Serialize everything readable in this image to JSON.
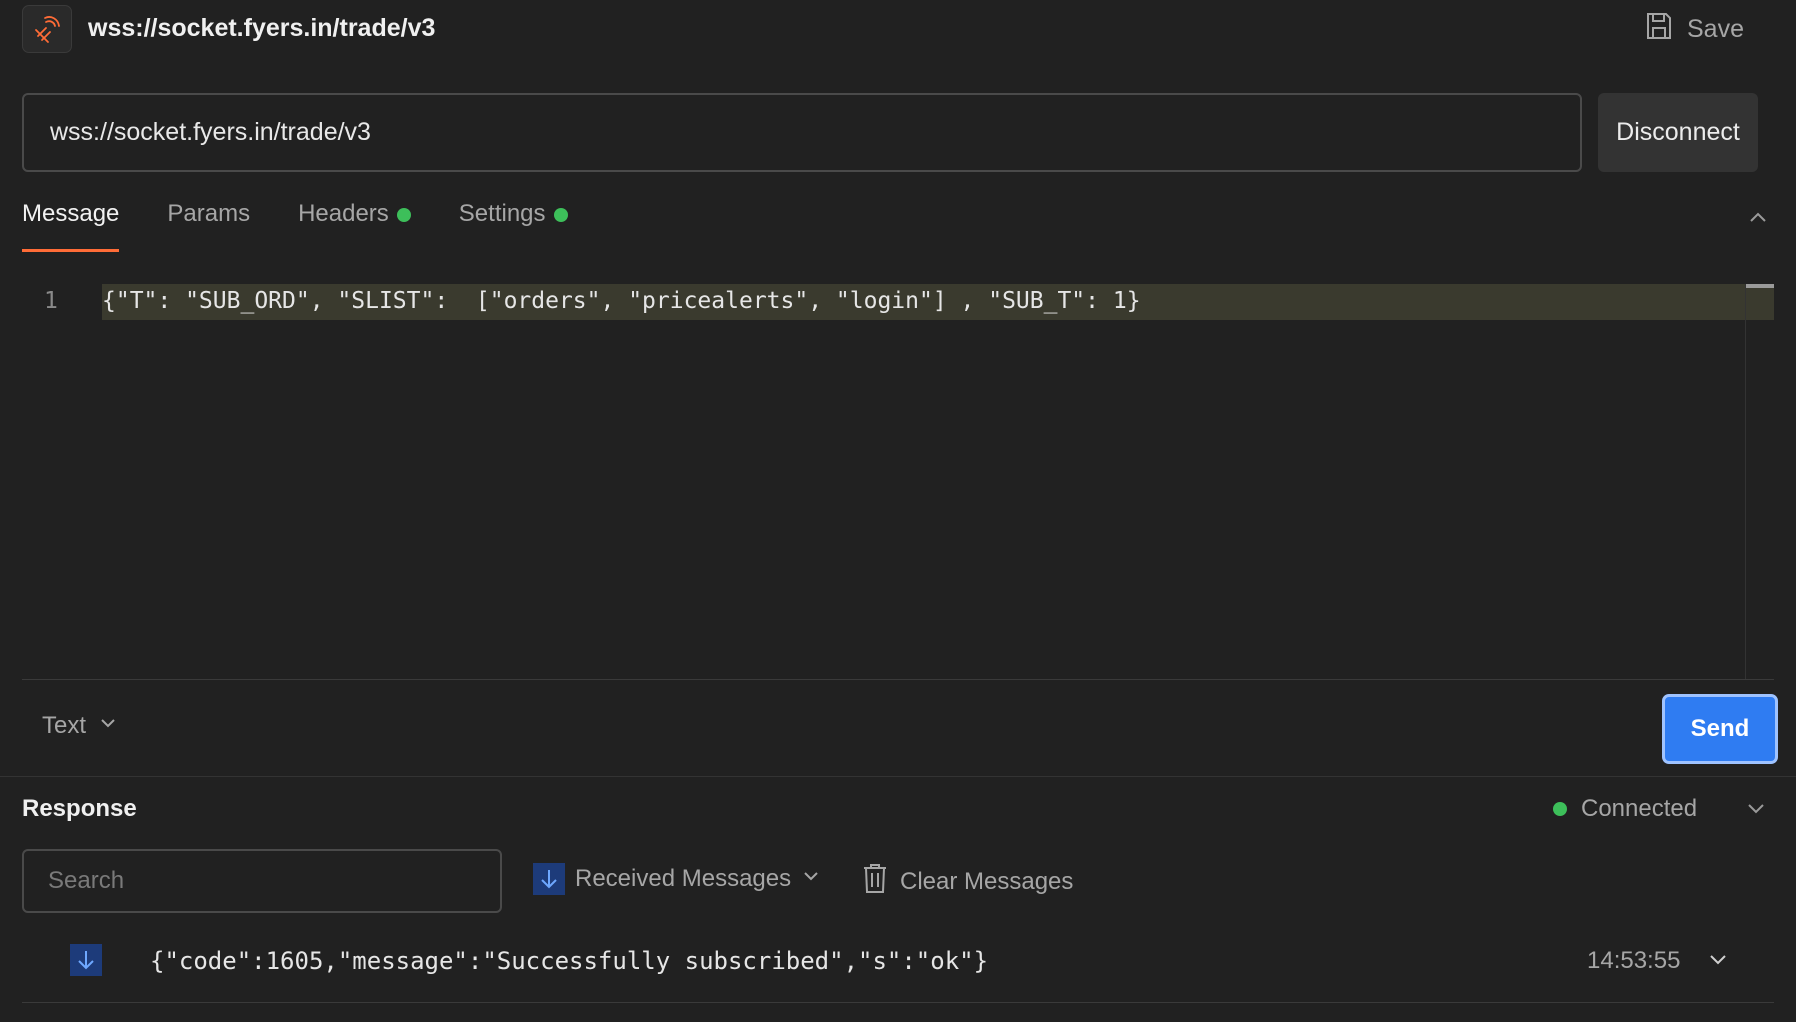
{
  "header": {
    "title": "wss://socket.fyers.in/trade/v3",
    "save_label": "Save"
  },
  "request": {
    "url": "wss://socket.fyers.in/trade/v3",
    "disconnect_label": "Disconnect"
  },
  "tabs": [
    {
      "label": "Message",
      "active": true,
      "dot": false
    },
    {
      "label": "Params",
      "active": false,
      "dot": false
    },
    {
      "label": "Headers",
      "active": false,
      "dot": true
    },
    {
      "label": "Settings",
      "active": false,
      "dot": true
    }
  ],
  "editor": {
    "line_number": "1",
    "code": "{\"T\": \"SUB_ORD\", \"SLIST\":  [\"orders\", \"pricealerts\", \"login\"] , \"SUB_T\": 1}"
  },
  "message_type": {
    "selected": "Text"
  },
  "send_label": "Send",
  "response": {
    "title": "Response",
    "status": "Connected",
    "search_placeholder": "Search",
    "filter_label": "Received Messages",
    "clear_label": "Clear Messages",
    "messages": [
      {
        "direction": "received",
        "text": "{\"code\":1605,\"message\":\"Successfully subscribed\",\"s\":\"ok\"}",
        "time": "14:53:55"
      }
    ]
  },
  "colors": {
    "accent": "#ff6c37",
    "send": "#2f7cf2",
    "connected": "#3dbf5a",
    "background": "#212121"
  },
  "icons": [
    "websocket-icon",
    "save-icon",
    "chevron-up-icon",
    "chevron-down-icon",
    "arrow-down-icon",
    "trash-icon"
  ]
}
